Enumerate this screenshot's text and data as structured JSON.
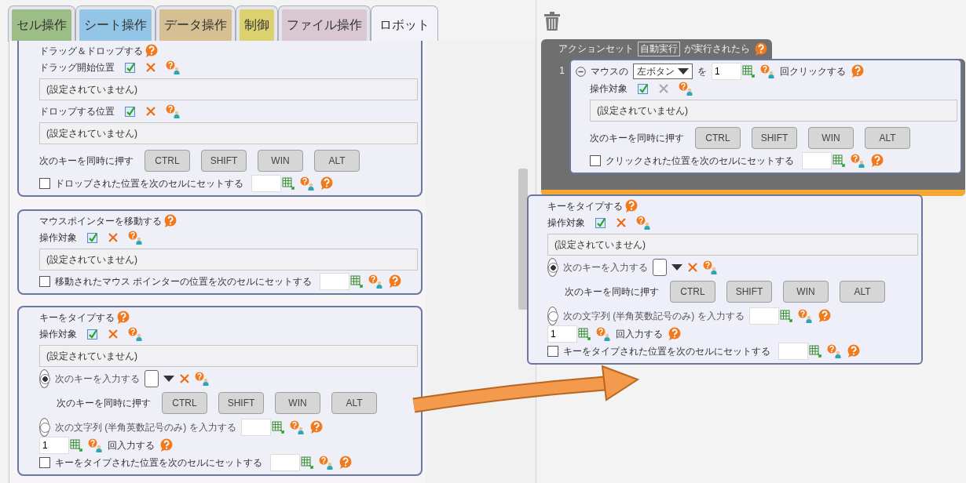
{
  "tabs": [
    {
      "label": "セル操作",
      "color": "#9dbd86",
      "selected": false
    },
    {
      "label": "シート操作",
      "color": "#93c6e6",
      "selected": false
    },
    {
      "label": "データ操作",
      "color": "#d6bf92",
      "selected": false
    },
    {
      "label": "制御",
      "color": "#ddd06e",
      "selected": false
    },
    {
      "label": "ファイル操作",
      "color": "#d9c8d2",
      "selected": false
    },
    {
      "label": "ロボット",
      "color": "#f2f2f8",
      "selected": true
    }
  ],
  "palette": {
    "cards": [
      {
        "title": "ドラッグ＆ドロップする",
        "rows": [
          {
            "kind": "target",
            "label": "ドラッグ開始位置",
            "clear_disabled": false
          },
          {
            "kind": "value",
            "text": "(設定されていません)"
          },
          {
            "kind": "target",
            "label": "ドロップする位置",
            "clear_disabled": false
          },
          {
            "kind": "value",
            "text": "(設定されていません)"
          },
          {
            "kind": "keys",
            "label": "次のキーを同時に押す",
            "keys": [
              "CTRL",
              "SHIFT",
              "WIN",
              "ALT"
            ]
          },
          {
            "kind": "checkbox",
            "label": "ドロップされた位置を次のセルにセットする",
            "checked": false
          }
        ]
      },
      {
        "title": "マウスポインターを移動する",
        "rows": [
          {
            "kind": "target",
            "label": "操作対象",
            "clear_disabled": false
          },
          {
            "kind": "value",
            "text": "(設定されていません)"
          },
          {
            "kind": "checkbox",
            "label": "移動されたマウス ポインターの位置を次のセルにセットする",
            "checked": false
          }
        ]
      },
      {
        "title": "キーをタイプする",
        "rows": [
          {
            "kind": "target",
            "label": "操作対象",
            "clear_disabled": false
          },
          {
            "kind": "value",
            "text": "(設定されていません)"
          },
          {
            "kind": "radio_key",
            "label": "次のキーを入力する",
            "selected": true,
            "keys_row": {
              "label": "次のキーを同時に押す",
              "keys": [
                "CTRL",
                "SHIFT",
                "WIN",
                "ALT"
              ]
            }
          },
          {
            "kind": "radio_text",
            "label": "次の文字列 (半角英数記号のみ) を入力する",
            "selected": false
          },
          {
            "kind": "repeat",
            "count": "1",
            "label": "回入力する"
          },
          {
            "kind": "checkbox",
            "label": "キーをタイプされた位置を次のセルにセットする",
            "checked": false
          }
        ]
      }
    ]
  },
  "workspace": {
    "action_set": {
      "label": "アクションセット",
      "trigger": "自動実行",
      "suffix": "が実行されたら",
      "steps": [
        {
          "number": "1",
          "card": {
            "rows": [
              {
                "kind": "click",
                "prefix": "マウスの",
                "button": "左ボタン",
                "mid": "を",
                "count": "1",
                "suffix": "回クリックする"
              },
              {
                "kind": "target",
                "label": "操作対象",
                "clear_disabled": true
              },
              {
                "kind": "value",
                "text": "(設定されていません)"
              },
              {
                "kind": "keys",
                "label": "次のキーを同時に押す",
                "keys": [
                  "CTRL",
                  "SHIFT",
                  "WIN",
                  "ALT"
                ]
              },
              {
                "kind": "checkbox",
                "label": "クリックされた位置を次のセルにセットする",
                "checked": false
              }
            ]
          }
        }
      ]
    },
    "dragged_card": {
      "title": "キーをタイプする",
      "rows": [
        {
          "kind": "target",
          "label": "操作対象",
          "clear_disabled": false
        },
        {
          "kind": "value",
          "text": "(設定されていません)"
        },
        {
          "kind": "radio_key",
          "label": "次のキーを入力する",
          "selected": true,
          "keys_row": {
            "label": "次のキーを同時に押す",
            "keys": [
              "CTRL",
              "SHIFT",
              "WIN",
              "ALT"
            ]
          }
        },
        {
          "kind": "radio_text",
          "label": "次の文字列 (半角英数記号のみ) を入力する",
          "selected": false
        },
        {
          "kind": "repeat",
          "count": "1",
          "label": "回入力する"
        },
        {
          "kind": "checkbox",
          "label": "キーをタイプされた位置を次のセルにセットする",
          "checked": false
        }
      ]
    }
  }
}
